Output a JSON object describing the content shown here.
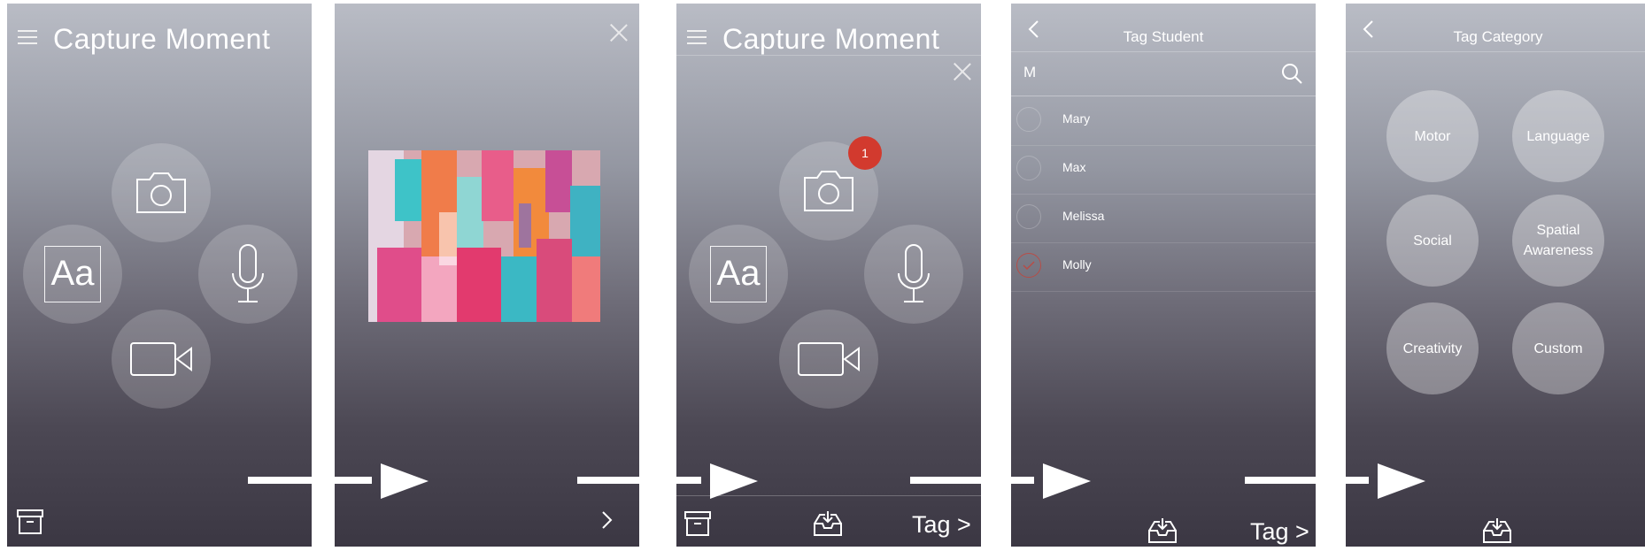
{
  "screen1": {
    "title": "Capture Moment",
    "text_button": "Aa"
  },
  "screen3": {
    "title": "Capture Moment",
    "text_button": "Aa",
    "badge_count": "1",
    "tag_button": "Tag >"
  },
  "screen4": {
    "header_title": "Tag Student",
    "search_value": "M",
    "students": [
      {
        "name": "Mary",
        "selected": false
      },
      {
        "name": "Max",
        "selected": false
      },
      {
        "name": "Melissa",
        "selected": false
      },
      {
        "name": "Molly",
        "selected": true
      }
    ],
    "tag_button": "Tag >"
  },
  "screen5": {
    "header_title": "Tag Category",
    "categories": [
      "Motor",
      "Language",
      "Social",
      "Spatial Awareness",
      "Creativity",
      "Custom"
    ]
  },
  "icons": [
    "menu-icon",
    "camera-icon",
    "microphone-icon",
    "video-icon",
    "archive-icon",
    "close-icon",
    "inbox-icon",
    "back-icon",
    "search-icon",
    "next-icon"
  ],
  "colors": {
    "badge": "#d23a2e",
    "selected_radio": "#d23a2e",
    "arrow": "#ffffff"
  }
}
